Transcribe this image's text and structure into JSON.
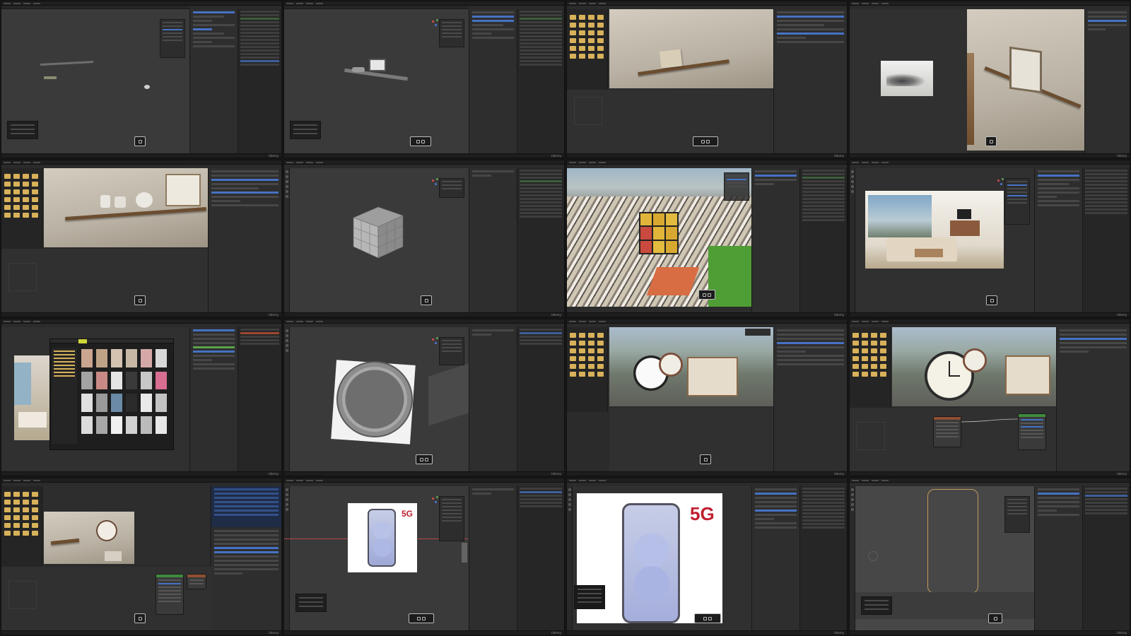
{
  "brand": "Udemy",
  "colors": {
    "blender_ui_dark": "#2b2b2b",
    "selection_blue": "#4672c4",
    "asset_folder_yellow": "#d8b25a",
    "brand_red": "#c01f2f"
  },
  "phone_badge": "5G",
  "tiles": [
    {
      "name": "shelf-wireframe-viewport"
    },
    {
      "name": "shelf-with-frame-viewport"
    },
    {
      "name": "shelf-render-preview"
    },
    {
      "name": "painting-reference-render"
    },
    {
      "name": "ceramics-shelf-render"
    },
    {
      "name": "cube-modeling-viewport"
    },
    {
      "name": "rubiks-cube-city-render"
    },
    {
      "name": "living-room-render"
    },
    {
      "name": "asset-browser-room"
    },
    {
      "name": "clock-base-modeling"
    },
    {
      "name": "clock-city-render"
    },
    {
      "name": "clock-nodes-render"
    },
    {
      "name": "clock-on-wall-render"
    },
    {
      "name": "phone-5g-camera-view"
    },
    {
      "name": "phone-5g-render"
    },
    {
      "name": "phone-wireframe-viewport"
    }
  ]
}
